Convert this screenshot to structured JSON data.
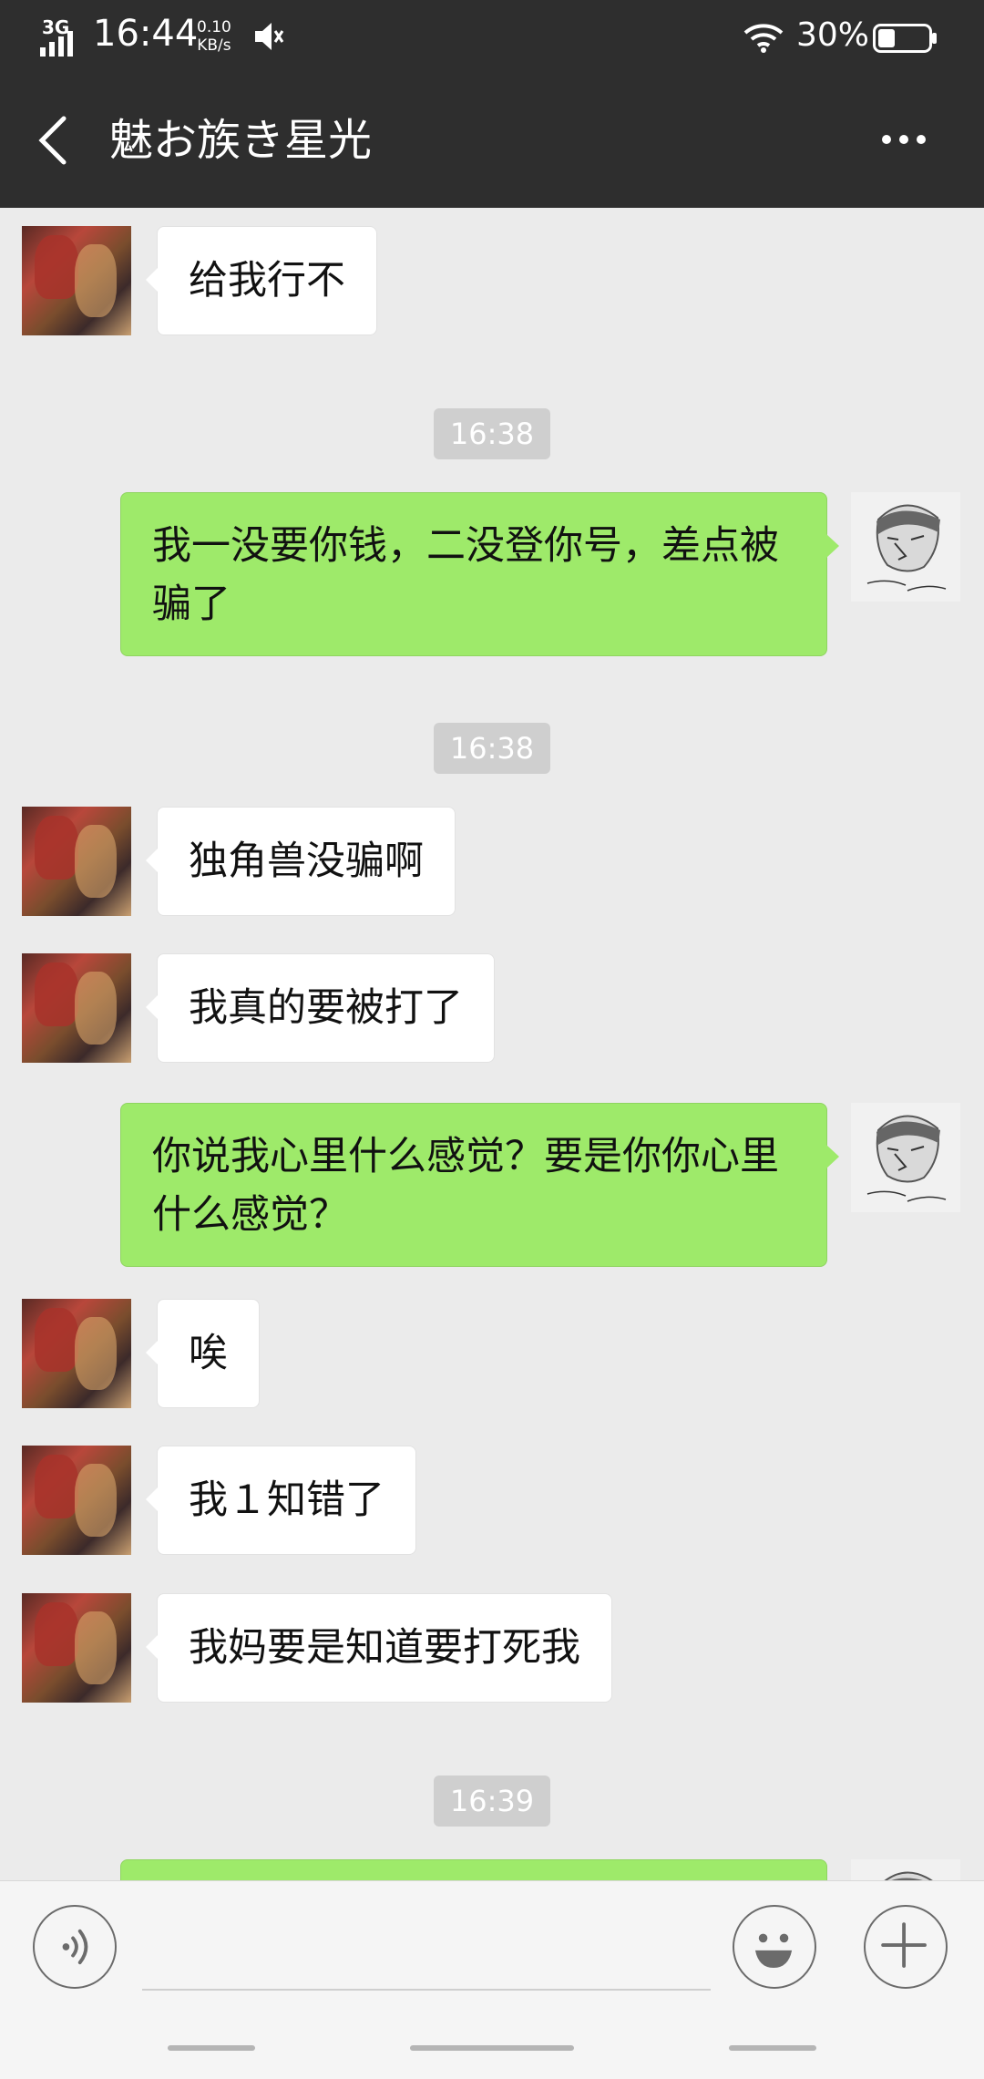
{
  "status_bar": {
    "network": "3G",
    "time": "16:44",
    "speed_value": "0.10",
    "speed_unit": "KB/s",
    "battery": "30%"
  },
  "header": {
    "title": "魅お族き星光"
  },
  "messages": [
    {
      "side": "left",
      "text": "给我行不"
    },
    {
      "type": "time",
      "text": "16:38"
    },
    {
      "side": "right",
      "text": "我一没要你钱，二没登你号，差点被骗了"
    },
    {
      "type": "time",
      "text": "16:38"
    },
    {
      "side": "left",
      "text": "独角兽没骗啊"
    },
    {
      "side": "left",
      "text": "我真的要被打了"
    },
    {
      "side": "right",
      "text": "你说我心里什么感觉？要是你你心里什么感觉？"
    },
    {
      "side": "left",
      "text": "唉"
    },
    {
      "side": "left",
      "text": "我１知错了"
    },
    {
      "side": "left",
      "text": "我妈要是知道要打死我"
    },
    {
      "type": "time",
      "text": "16:39"
    }
  ],
  "icons": {
    "back": "back-arrow-icon",
    "more": "more-dots-icon",
    "voice": "voice-icon",
    "emoji": "emoji-icon",
    "plus": "plus-icon"
  },
  "colors": {
    "nav_bg": "#2e2e2e",
    "chat_bg": "#ebebeb",
    "sent_bubble": "#9eea6a",
    "received_bubble": "#ffffff"
  }
}
